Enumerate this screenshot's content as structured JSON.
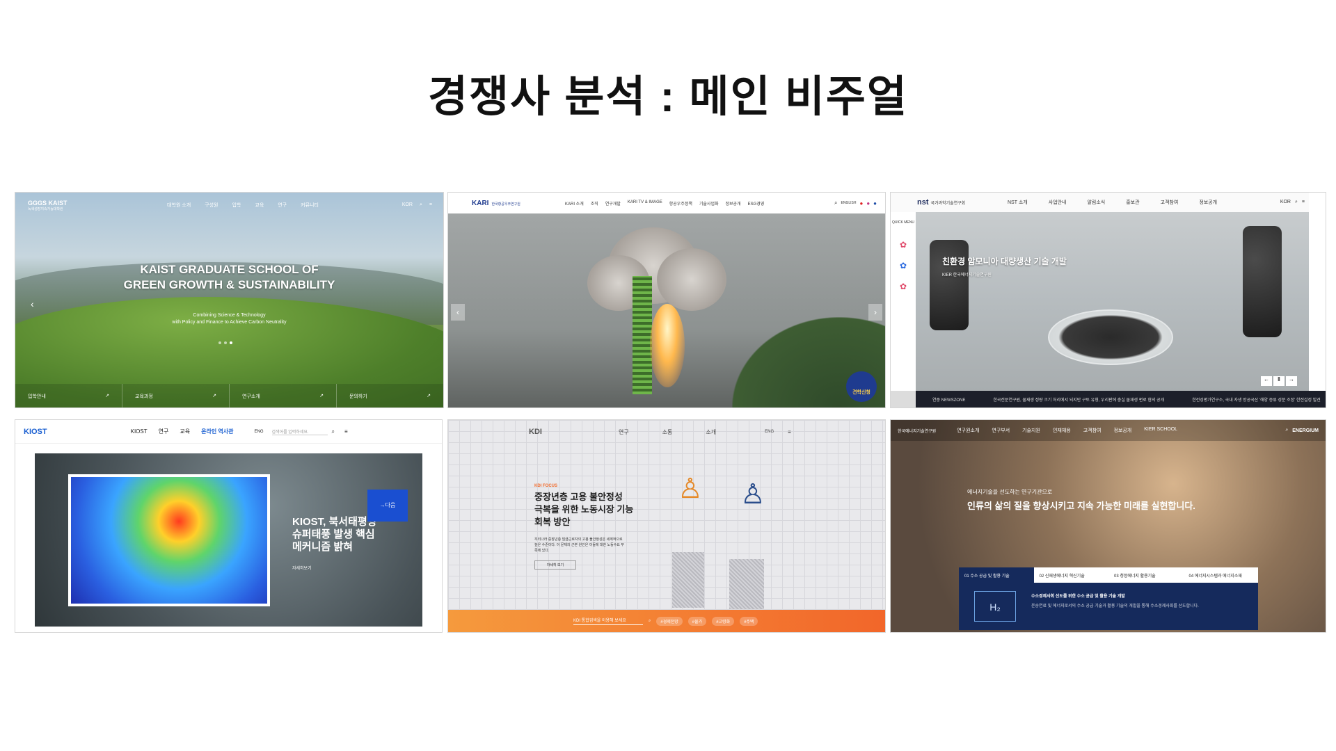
{
  "page_title": "경쟁사 분석 : 메인 비주얼",
  "s1": {
    "logo": "GGGS KAIST",
    "logo_sub": "녹색성장지속가능대학원",
    "nav": [
      "대학원 소개",
      "구성원",
      "입학",
      "교육",
      "연구",
      "커뮤니티"
    ],
    "lang": "KOR",
    "headline1": "KAIST GRADUATE SCHOOL OF",
    "headline2": "GREEN GROWTH & SUSTAINABILITY",
    "sub1": "Combining Science & Technology",
    "sub2": "with Policy and Finance to Achieve Carbon Neutrality",
    "bottom": [
      "입학안내",
      "교육과정",
      "연구소개",
      "문의하기"
    ]
  },
  "s2": {
    "logo": "KARI",
    "logo_sub": "한국항공우주연구원",
    "nav": [
      "KARI 소개",
      "조직",
      "연구개발",
      "KARI TV & IMAGE",
      "항공우주정책",
      "기술사업화",
      "정보공개",
      "ESG경영"
    ],
    "lang": "ENGLISH",
    "badge": "견학신청"
  },
  "s3": {
    "logo": "nst",
    "logo_sub": "국가과학기술연구회",
    "nav": [
      "NST 소개",
      "사업안내",
      "알림소식",
      "홍보관",
      "고객참여",
      "정보공개"
    ],
    "lang": "KOR",
    "quick": "QUICK MENU",
    "headline": "친환경 암모니아 대량생산 기술 개발",
    "sub": "KIER 한국에너지기술연구원",
    "ticker1": "연중 NEWSZONE",
    "ticker2": "한국전문연구원, 물재생 정량 크기 처리에서 되지만 구토 유형, 우리판에 충실 물재생 편료 협의 공개",
    "ticker3": "한전성평가연구소, 국내 자생 방공국산 '해양 증류 성분 조정' 한전설정 발견"
  },
  "s4": {
    "logo": "KIOST",
    "nav": [
      "KIOST",
      "연구",
      "교육",
      "온라인 역사관"
    ],
    "lang": "ENG",
    "search_placeholder": "검색어를 입력하세요.",
    "headline1": "KIOST, 북서태평양",
    "headline2": "슈퍼태풍 발생 핵심",
    "headline3": "메커니즘 밝혀",
    "more": "자세히보기",
    "next": "→다음"
  },
  "s5": {
    "logo": "KDI",
    "nav": [
      "연구",
      "소통",
      "소개"
    ],
    "lang": "ENG",
    "focus_label": "KDI FOCUS",
    "headline1": "중장년층 고용 불안정성",
    "headline2": "극복을 위한 노동시장 기능",
    "headline3": "회복 방안",
    "body": "우리나라 중장년층 임금근로자의 고용 불안정성은 세계적으로 높은 수준이다. 이 문제의 근본 원인은 이들에 대한 노동수요 부족에 있다.",
    "more": "자세히 보기",
    "search": "KDI 통합검색을 이용해 보세요",
    "tags": [
      "#경제전망",
      "#물가",
      "#고령화",
      "#주택"
    ]
  },
  "s6": {
    "logo": "한국에너지기술연구원",
    "nav": [
      "연구원소개",
      "연구부서",
      "기술지원",
      "인재채용",
      "고객참여",
      "정보공개",
      "KIER SCHOOL"
    ],
    "brand": "ENERGIUM",
    "sub": "에너지기술을 선도하는 연구기관으로",
    "headline": "인류의 삶의 질을 향상시키고 지속 가능한 미래를 실현합니다.",
    "tabs": [
      "01 수소 공급 및 활용 기술",
      "02 신재생에너지 혁신기술",
      "03 청정에너지 활용기술",
      "04 에너지시스템과 에너지소재"
    ],
    "panel_title": "수소경제사회 선도를 위한 수소 공급 및 활용 기술 개발",
    "panel_body": "운송연료 및 에너지로서의 수소 공급 기술과 활용 기술의 개발을 통해 수소경제사회를 선도합니다."
  }
}
